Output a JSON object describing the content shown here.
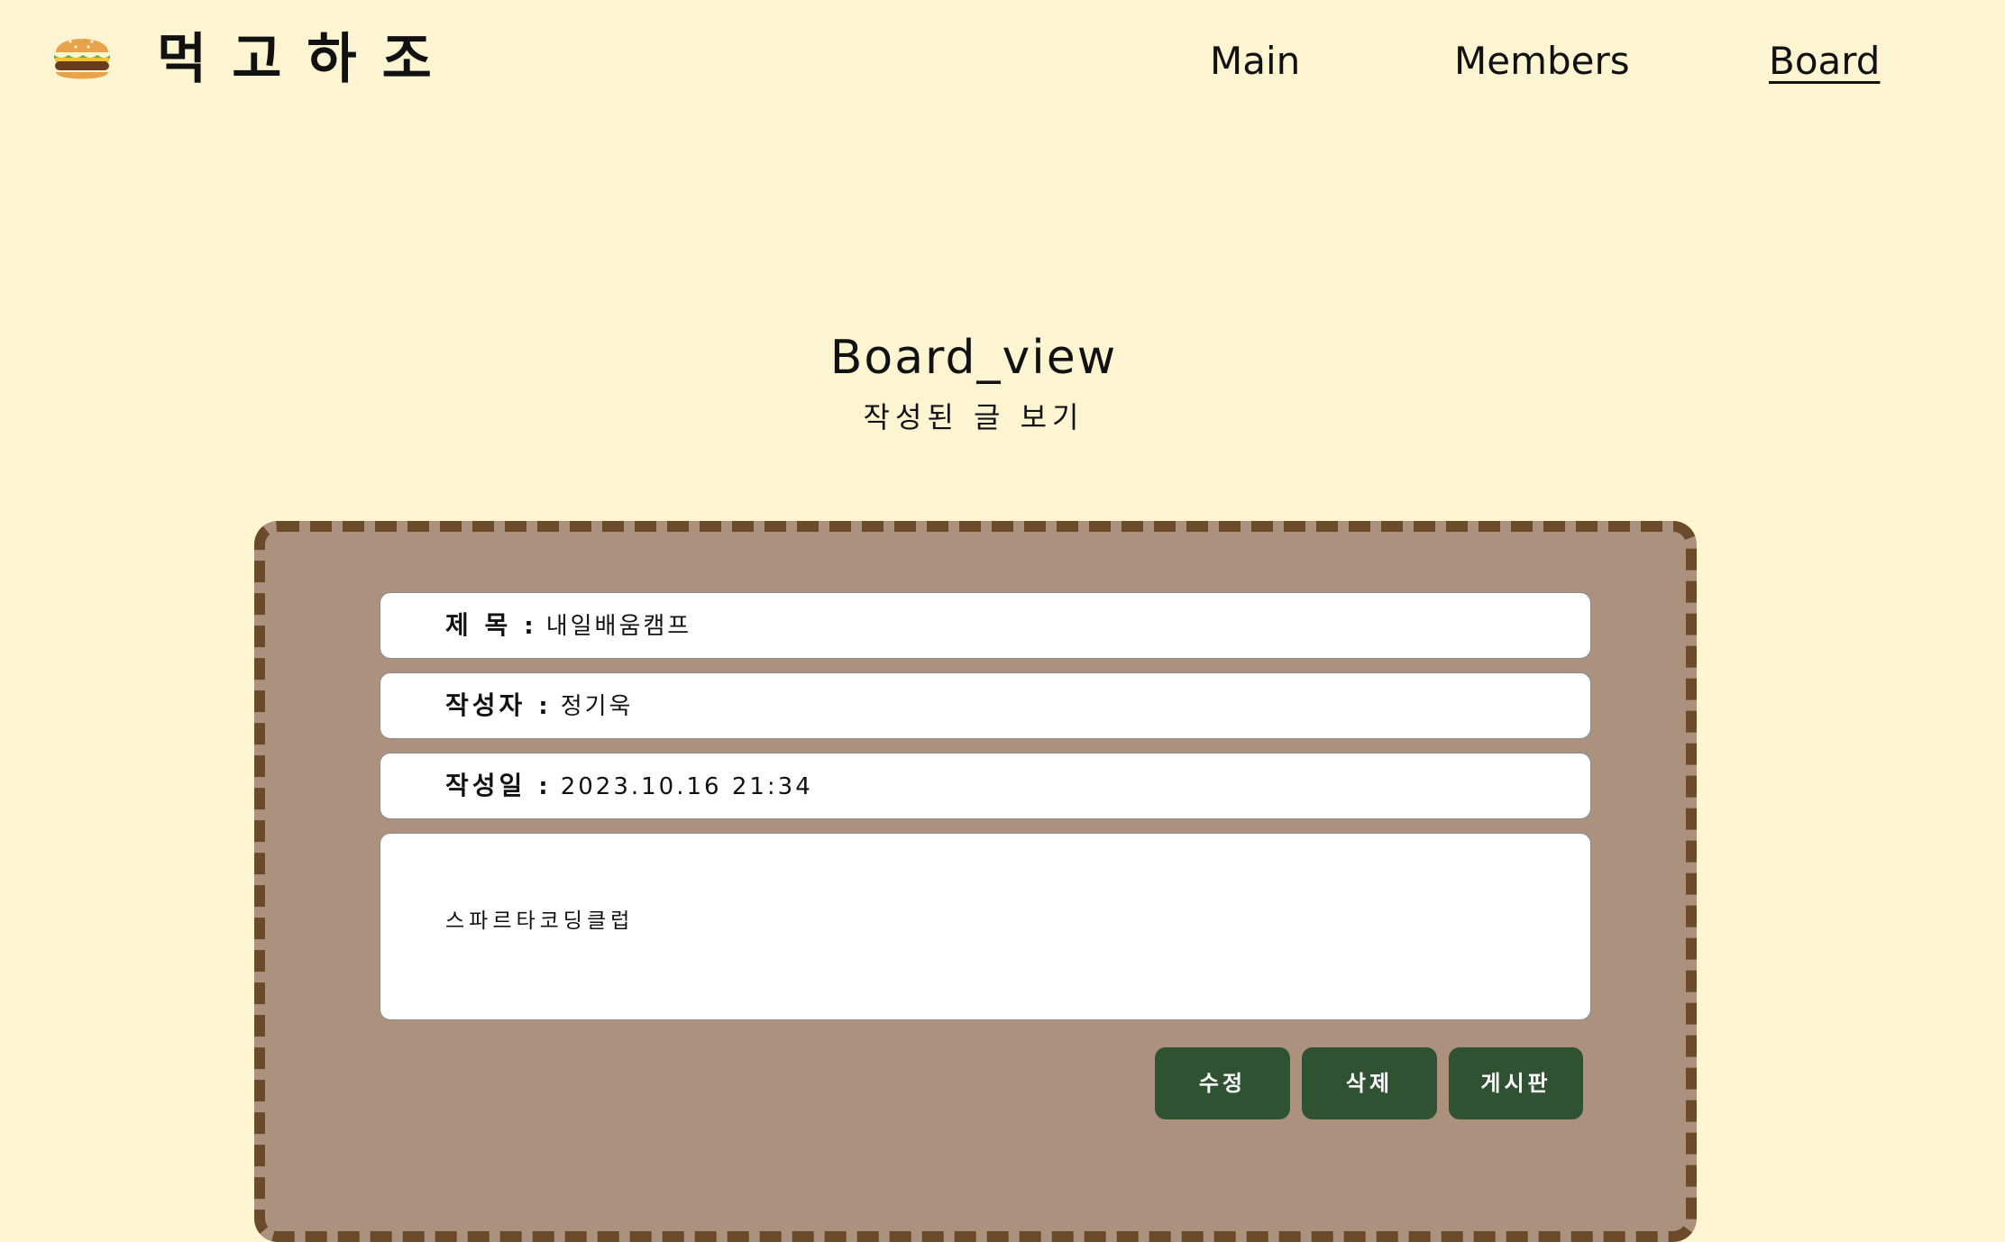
{
  "header": {
    "logo_icon": "hamburger-icon",
    "site_title": "먹고하조",
    "nav": {
      "main": "Main",
      "members": "Members",
      "board": "Board"
    },
    "active_nav": "Board"
  },
  "page": {
    "title": "Board_view",
    "subtitle": "작성된 글 보기"
  },
  "post": {
    "title_label": "제 목",
    "title_value": "내일배움캠프",
    "author_label": "작성자",
    "author_value": "정기욱",
    "date_label": "작성일",
    "date_value": "2023.10.16 21:34",
    "separator": ":",
    "content": "스파르타코딩클럽"
  },
  "buttons": {
    "edit": "수정",
    "delete": "삭제",
    "list": "게시판"
  },
  "colors": {
    "background": "#fdf5d2",
    "card": "#ac927e",
    "card_border": "#6b4a2a",
    "button": "#2f5233"
  }
}
